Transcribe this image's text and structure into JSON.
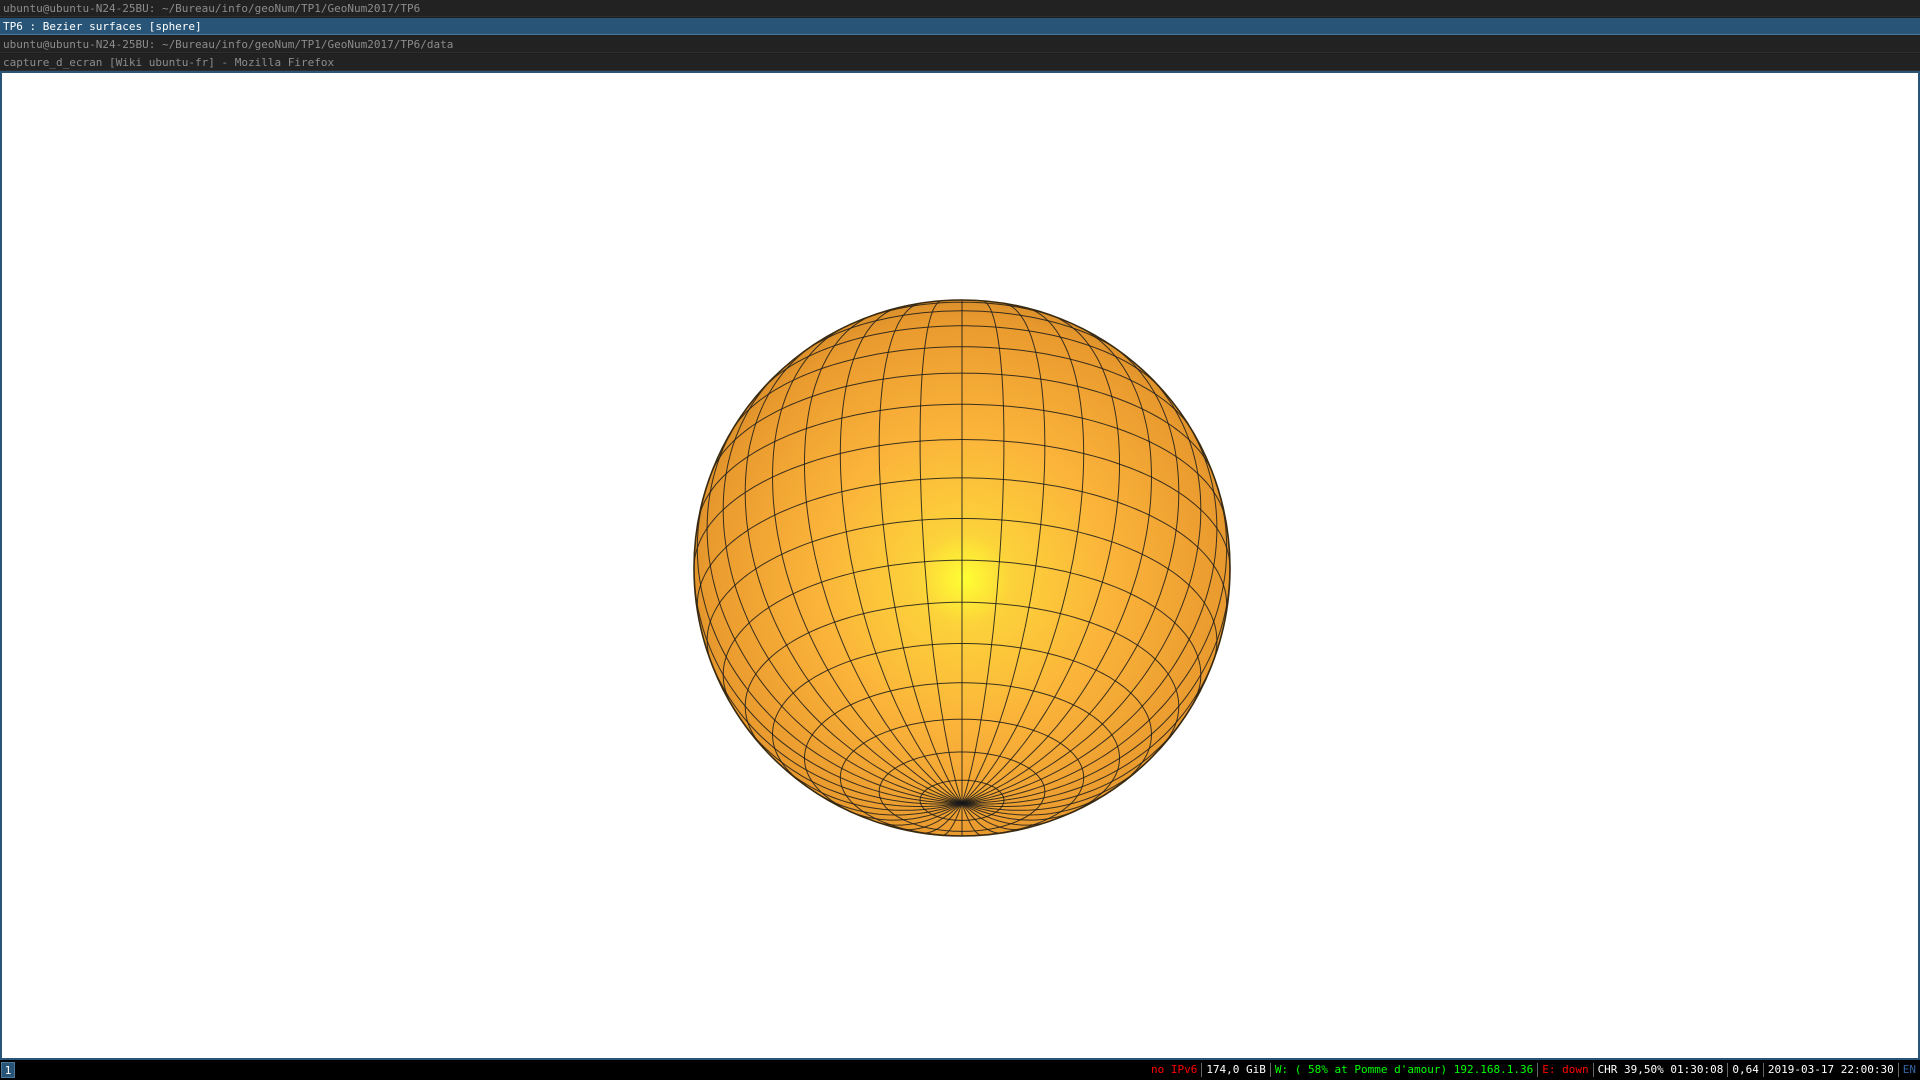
{
  "windows": {
    "terminal_1_title": "ubuntu@ubuntu-N24-25BU: ~/Bureau/info/geoNum/TP1/GeoNum2017/TP6",
    "active_title": "TP6 : Bezier surfaces [sphere]",
    "terminal_2_title": "ubuntu@ubuntu-N24-25BU: ~/Bureau/info/geoNum/TP1/GeoNum2017/TP6/data",
    "firefox_title": "capture_d_ecran [Wiki ubuntu-fr] - Mozilla Firefox"
  },
  "viewport": {
    "object": "sphere",
    "colors": {
      "surface_highlight": "#ffff33",
      "surface_base": "#fbb33a",
      "surface_shadow": "#b8751f",
      "wireframe": "#1a1a1a",
      "background": "#ffffff"
    }
  },
  "statusbar": {
    "workspace": "1",
    "ipv6": "no IPv6",
    "disk": "174,0 GiB",
    "wifi": "W: ( 58% at Pomme d'amour) 192.168.1.36",
    "ethernet": "E: down",
    "battery": "CHR 39,50% 01:30:08",
    "load": "0,64",
    "datetime": "2019-03-17 22:00:30",
    "layout": "EN",
    "colors": {
      "bad": "#ff0000",
      "good": "#00ff00",
      "neutral": "#ffffff",
      "accent": "#3465a4"
    }
  }
}
